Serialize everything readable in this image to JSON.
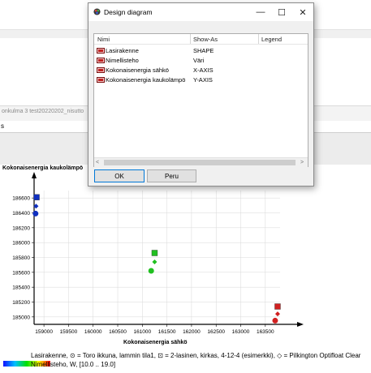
{
  "background_window": {
    "title": "onkulma 3 test20220202_nisutto",
    "menu_label": "s"
  },
  "dialog": {
    "title": "Design diagram",
    "window_controls": {
      "minimize": "—",
      "maximize": "☐",
      "close": "✕"
    },
    "columns": [
      "Nimi",
      "Show-As",
      "Legend"
    ],
    "rows": [
      {
        "name": "Lasirakenne",
        "show_as": "SHAPE"
      },
      {
        "name": "Nimellisteho",
        "show_as": "Väri"
      },
      {
        "name": "Kokonaisenergia sähkö",
        "show_as": "X-AXIS"
      },
      {
        "name": "Kokonaisenergia kaukolämpö",
        "show_as": "Y-AXIS"
      }
    ],
    "scroll_left": "<",
    "scroll_right": ">",
    "ok_label": "OK",
    "cancel_label": "Peru"
  },
  "chart_legend": {
    "shape_text": "Lasirakenne, ⊙ = Toro ikkuna, lammin tila1, ⊡ = 2-lasinen, kirkas, 4-12-4 (esimerkki), ◇ = Pilkington Optifloat Clear",
    "color_text": "Nimellisteho, W, [10.0 .. 19.0]"
  },
  "chart_data": {
    "type": "scatter",
    "xlabel": "Kokonaisenergia sähkö",
    "ylabel": "Kokonaisenergia kaukolämpö",
    "x_ticks": [
      159000,
      159500,
      160000,
      160500,
      161000,
      161500,
      162000,
      162500,
      163000,
      163500
    ],
    "y_ticks": [
      185000,
      185200,
      185400,
      185600,
      185800,
      186000,
      186200,
      186400,
      186600
    ],
    "xlim": [
      158800,
      163800
    ],
    "ylim": [
      184900,
      186700
    ],
    "points": [
      {
        "x": 158850,
        "y": 186610,
        "shape": "square",
        "color": "#1030c0"
      },
      {
        "x": 158840,
        "y": 186490,
        "shape": "diamond",
        "color": "#1030c0"
      },
      {
        "x": 158830,
        "y": 186390,
        "shape": "circle",
        "color": "#1030c0"
      },
      {
        "x": 161250,
        "y": 185860,
        "shape": "square",
        "color": "#20c020"
      },
      {
        "x": 161250,
        "y": 185740,
        "shape": "diamond",
        "color": "#20c020"
      },
      {
        "x": 161180,
        "y": 185620,
        "shape": "circle",
        "color": "#20c020"
      },
      {
        "x": 163750,
        "y": 185140,
        "shape": "square",
        "color": "#d02020"
      },
      {
        "x": 163750,
        "y": 185040,
        "shape": "diamond",
        "color": "#d02020"
      },
      {
        "x": 163700,
        "y": 184950,
        "shape": "circle",
        "color": "#d02020"
      }
    ],
    "grid": true
  }
}
